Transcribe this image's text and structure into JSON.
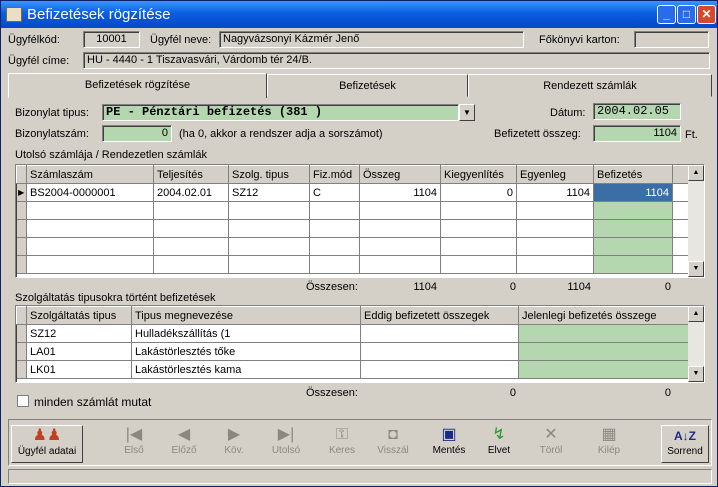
{
  "window": {
    "title": "Befizetések rögzítése",
    "min": "_",
    "max": "□",
    "close": "✕"
  },
  "header": {
    "ugyfelkod_label": "Ügyfélkód:",
    "ugyfelkod": "10001",
    "ugyfelnev_label": "Ügyfél neve:",
    "ugyfelnev": "Nagyvázsonyi Kázmér Jenő",
    "fokonyvi_label": "Főkönyvi karton:",
    "fokonyvi": "",
    "cim_label": "Ügyfél címe:",
    "cim": "HU - 4440  - 1 Tiszavasvári, Várdomb tér 24/B."
  },
  "tabs": [
    {
      "label": "Befizetések rögzítése"
    },
    {
      "label": "Befizetések"
    },
    {
      "label": "Rendezett számlák"
    }
  ],
  "form": {
    "bizonylat_tipus_label": "Bizonylat tipus:",
    "bizonylat_tipus": "PE - Pénztári befizetés         (381      )",
    "datum_label": "Dátum:",
    "datum": "2004.02.05",
    "bizonylatszam_label": "Bizonylatszám:",
    "bizonylatszam": "0",
    "bizonylatszam_hint": "(ha 0, akkor a rendszer adja a sorszámot)",
    "befizetett_label": "Befizetett összeg:",
    "befizetett": "1104",
    "ft": "Ft."
  },
  "invoices": {
    "title": "Utolsó számlája / Rendezetlen számlák",
    "columns": [
      "Számlaszám",
      "Teljesítés",
      "Szolg. tipus",
      "Fiz.mód",
      "Összeg",
      "Kiegyenlítés",
      "Egyenleg",
      "Befizetés"
    ],
    "rows": [
      {
        "szamlaszam": "BS2004-0000001",
        "teljesites": "2004.02.01",
        "szolg": "SZ12",
        "fizmod": "C",
        "osszeg": "1104",
        "kiegy": "0",
        "egyenleg": "1104",
        "befizetes": "1104"
      }
    ],
    "totals": {
      "label": "Összesen:",
      "osszeg": "1104",
      "kiegy": "0",
      "egyenleg": "1104",
      "befizetes": "0"
    }
  },
  "services": {
    "title": "Szolgáltatás tipusokra történt befizetések",
    "columns": [
      "Szolgáltatás tipus",
      "Tipus megnevezése",
      "Eddig befizetett összegek",
      "Jelenlegi befizetés összege"
    ],
    "rows": [
      {
        "tipus": "SZ12",
        "nev": "Hulladékszállítás (1"
      },
      {
        "tipus": "LA01",
        "nev": "Lakástörlesztés tőke"
      },
      {
        "tipus": "LK01",
        "nev": "Lakástörlesztés kama"
      }
    ],
    "totals": {
      "label": "Összesen:",
      "eddig": "0",
      "jelenlegi": "0"
    }
  },
  "show_all_label": "minden számlát mutat",
  "toolbar": [
    {
      "label": "Ügyfél adatai",
      "icon": "people-icon",
      "enabled": true
    },
    {
      "label": "Első",
      "icon": "first-icon",
      "enabled": false
    },
    {
      "label": "Előző",
      "icon": "prev-icon",
      "enabled": false
    },
    {
      "label": "Köv.",
      "icon": "next-icon",
      "enabled": false
    },
    {
      "label": "Utolsó",
      "icon": "last-icon",
      "enabled": false
    },
    {
      "label": "Keres",
      "icon": "key-icon",
      "enabled": false
    },
    {
      "label": "Visszál",
      "icon": "bag-icon",
      "enabled": false
    },
    {
      "label": "Mentés",
      "icon": "save-icon",
      "enabled": true
    },
    {
      "label": "Elvet",
      "icon": "discard-icon",
      "enabled": true
    },
    {
      "label": "Töröl",
      "icon": "delete-icon",
      "enabled": false
    },
    {
      "label": "Kilép",
      "icon": "exit-icon",
      "enabled": false
    },
    {
      "label": "Sorrend",
      "icon": "sort-icon",
      "enabled": true
    }
  ]
}
